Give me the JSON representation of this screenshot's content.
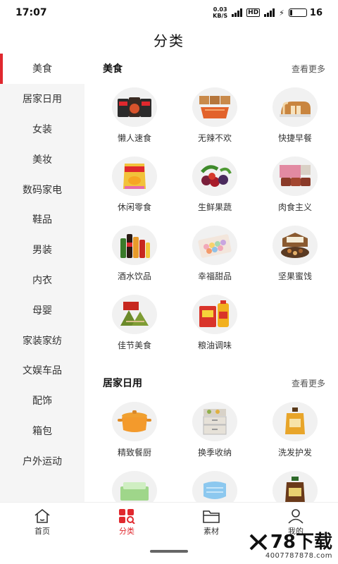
{
  "status": {
    "time": "17:07",
    "speed_top": "0.03",
    "speed_bottom": "KB/S",
    "network_label": "HD",
    "battery": "16"
  },
  "header": {
    "title": "分类"
  },
  "sidebar": {
    "items": [
      {
        "label": "美食",
        "active": true
      },
      {
        "label": "居家日用"
      },
      {
        "label": "女装"
      },
      {
        "label": "美妆"
      },
      {
        "label": "数码家电"
      },
      {
        "label": "鞋品"
      },
      {
        "label": "男装"
      },
      {
        "label": "内衣"
      },
      {
        "label": "母婴"
      },
      {
        "label": "家装家纺"
      },
      {
        "label": "文娱车品"
      },
      {
        "label": "配饰"
      },
      {
        "label": "箱包"
      },
      {
        "label": "户外运动"
      }
    ]
  },
  "sections": [
    {
      "title": "美食",
      "more": "查看更多",
      "items": [
        {
          "label": "懒人速食",
          "icon": "instant-noodles-icon"
        },
        {
          "label": "无辣不欢",
          "icon": "spicy-snack-icon"
        },
        {
          "label": "快捷早餐",
          "icon": "bread-icon"
        },
        {
          "label": "休闲零食",
          "icon": "chips-icon"
        },
        {
          "label": "生鲜果蔬",
          "icon": "fruit-icon"
        },
        {
          "label": "肉食主义",
          "icon": "meat-icon"
        },
        {
          "label": "酒水饮品",
          "icon": "drinks-icon"
        },
        {
          "label": "幸福甜品",
          "icon": "macaron-icon"
        },
        {
          "label": "坚果蜜饯",
          "icon": "nuts-icon"
        },
        {
          "label": "佳节美食",
          "icon": "zongzi-icon"
        },
        {
          "label": "粮油调味",
          "icon": "rice-oil-icon"
        }
      ]
    },
    {
      "title": "居家日用",
      "more": "查看更多",
      "items": [
        {
          "label": "精致餐厨",
          "icon": "pot-icon"
        },
        {
          "label": "换季收纳",
          "icon": "storage-box-icon"
        },
        {
          "label": "洗发护发",
          "icon": "shampoo-icon"
        },
        {
          "label": "",
          "icon": "tissue-icon"
        },
        {
          "label": "",
          "icon": "mask-icon"
        },
        {
          "label": "",
          "icon": "disinfectant-icon"
        }
      ]
    }
  ],
  "tabbar": {
    "tabs": [
      {
        "label": "首页",
        "icon": "home-icon"
      },
      {
        "label": "分类",
        "icon": "category-icon",
        "active": true
      },
      {
        "label": "素材",
        "icon": "folder-icon"
      },
      {
        "label": "我的",
        "icon": "user-icon"
      }
    ]
  },
  "watermark": {
    "main": "78下载",
    "sub": "4007787878.com"
  },
  "colors": {
    "accent": "#e0282e",
    "sidebar_bg": "#f5f5f5",
    "thumb_bg": "#f1f1f1"
  }
}
